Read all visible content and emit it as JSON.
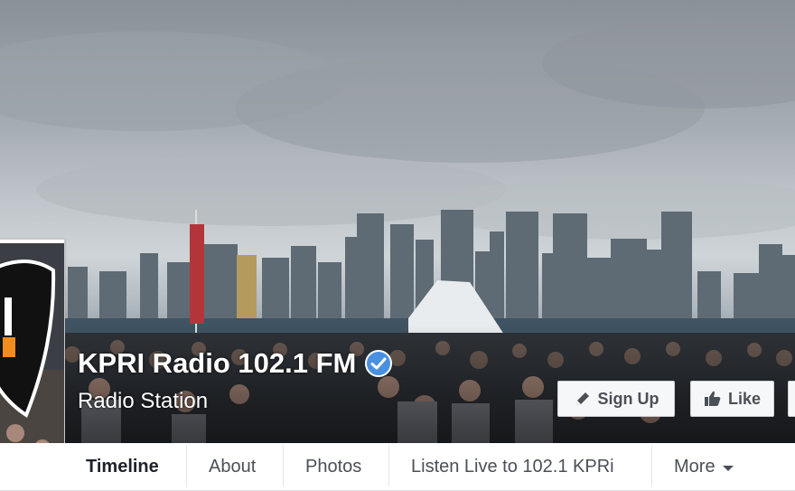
{
  "page": {
    "title": "KPRI Radio 102.1 FM",
    "category": "Radio Station"
  },
  "actions": {
    "signup_label": "Sign Up",
    "like_label": "Like"
  },
  "tabs": [
    {
      "label": "Timeline",
      "active": true
    },
    {
      "label": "About"
    },
    {
      "label": "Photos"
    },
    {
      "label": "Listen Live to 102.1 KPRi"
    },
    {
      "label": "More"
    }
  ],
  "colors": {
    "verified_badge": "#4a90e2",
    "tab_text": "#4b4f56",
    "active_tab_text": "#1d2129"
  },
  "icons": {
    "verified": "verified-badge-icon",
    "signup": "pencil-icon",
    "like": "thumbs-up-icon",
    "more": "caret-down-icon"
  }
}
